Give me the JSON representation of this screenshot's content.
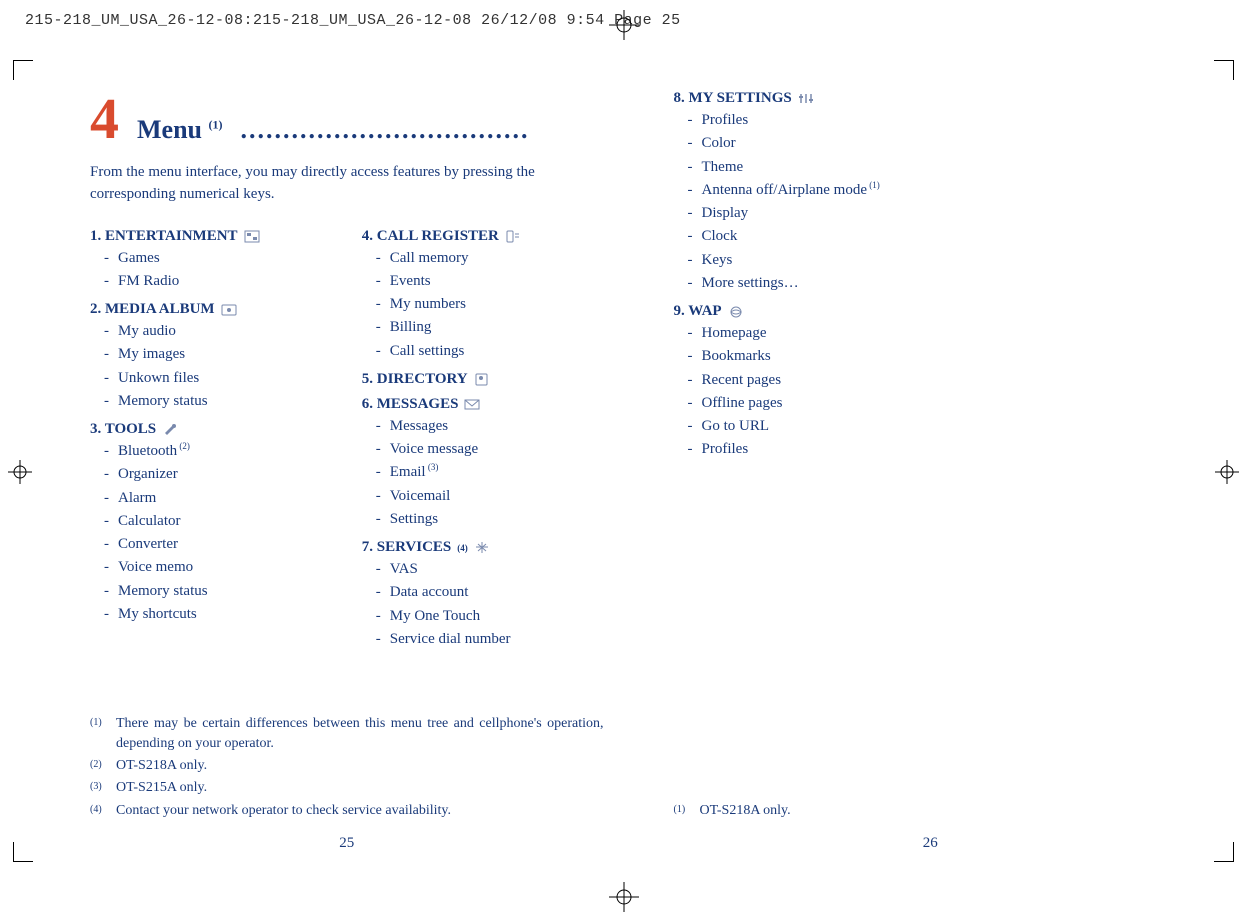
{
  "slug": "215-218_UM_USA_26-12-08:215-218_UM_USA_26-12-08  26/12/08  9:54  Page 25",
  "chapter": {
    "num": "4",
    "title": "Menu",
    "title_sup": "(1)",
    "dots": ".................................."
  },
  "intro": "From the menu interface, you may directly access features by pressing the corresponding numerical keys.",
  "s1": {
    "head": "1. ENTERTAINMENT",
    "items": [
      "Games",
      "FM Radio"
    ]
  },
  "s2": {
    "head": "2. MEDIA ALBUM",
    "items": [
      "My audio",
      "My images",
      "Unkown files",
      "Memory status"
    ]
  },
  "s3": {
    "head": "3. TOOLS",
    "items_special": [
      {
        "t": "Bluetooth",
        "sup": "(2)"
      },
      {
        "t": "Organizer"
      },
      {
        "t": "Alarm"
      },
      {
        "t": "Calculator"
      },
      {
        "t": "Converter"
      },
      {
        "t": "Voice memo"
      },
      {
        "t": "Memory status"
      },
      {
        "t": "My shortcuts"
      }
    ]
  },
  "s4": {
    "head": "4. CALL REGISTER",
    "items": [
      "Call memory",
      "Events",
      "My numbers",
      "Billing",
      "Call settings"
    ]
  },
  "s5": {
    "head": "5. DIRECTORY"
  },
  "s6": {
    "head": "6. MESSAGES",
    "items_special": [
      {
        "t": "Messages"
      },
      {
        "t": "Voice message"
      },
      {
        "t": "Email",
        "sup": "(3)"
      },
      {
        "t": "Voicemail"
      },
      {
        "t": "Settings"
      }
    ]
  },
  "s7": {
    "head": "7. SERVICES",
    "head_sup": "(4)",
    "items": [
      "VAS",
      "Data account",
      "My One Touch",
      "Service dial number"
    ]
  },
  "s8": {
    "head": "8. MY SETTINGS",
    "items_special": [
      {
        "t": "Profiles"
      },
      {
        "t": "Color"
      },
      {
        "t": "Theme"
      },
      {
        "t": "Antenna off/Airplane mode",
        "sup": "(1)"
      },
      {
        "t": "Display"
      },
      {
        "t": "Clock"
      },
      {
        "t": "Keys"
      },
      {
        "t": "More settings…"
      }
    ]
  },
  "s9": {
    "head": "9. WAP",
    "items": [
      "Homepage",
      "Bookmarks",
      "Recent pages",
      "Offline pages",
      "Go to URL",
      "Profiles"
    ]
  },
  "footnotes_left": [
    {
      "idx": "(1)",
      "txt": "There may be certain differences between this menu tree and cellphone's operation, depending on your operator.",
      "justify": true
    },
    {
      "idx": "(2)",
      "txt": "OT-S218A only."
    },
    {
      "idx": "(3)",
      "txt": "OT-S215A only."
    },
    {
      "idx": "(4)",
      "txt": "Contact your network operator to check service availability."
    }
  ],
  "footnotes_right": [
    {
      "idx": "(1)",
      "txt": "OT-S218A only."
    }
  ],
  "pagenum_left": "25",
  "pagenum_right": "26"
}
